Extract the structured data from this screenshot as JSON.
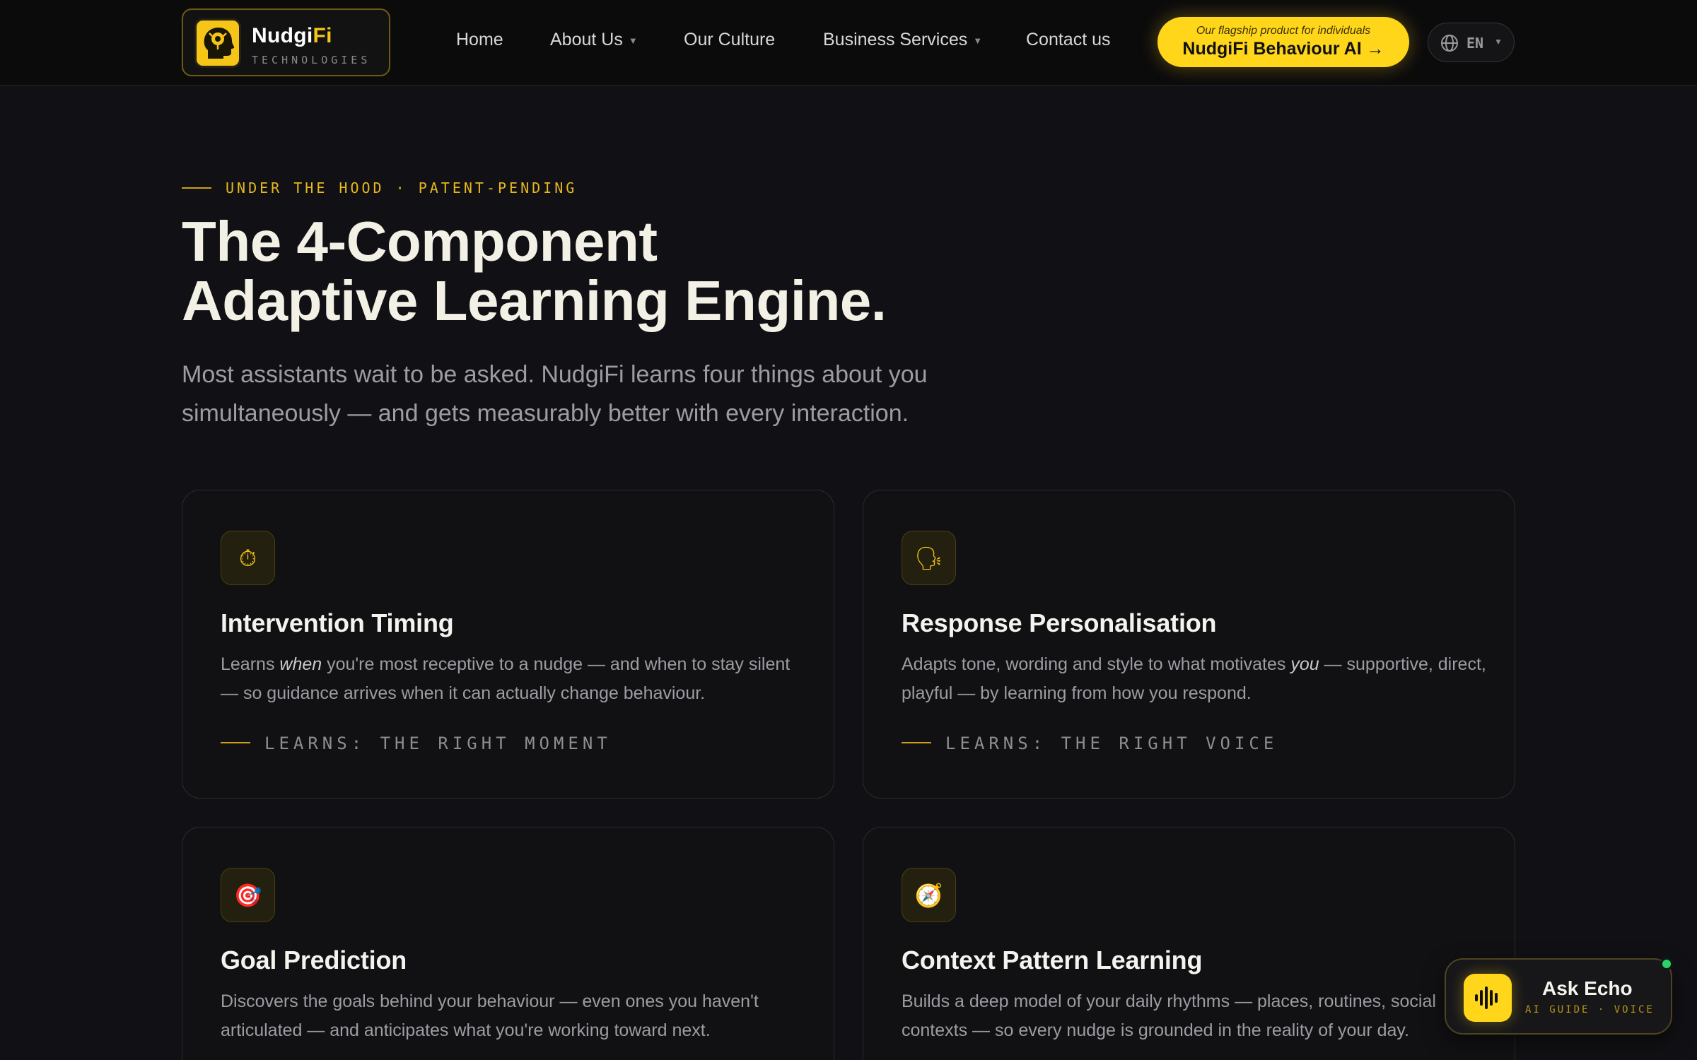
{
  "header": {
    "brand": {
      "name_main": "Nudgi",
      "name_accent": "Fi",
      "subtitle": "TECHNOLOGIES"
    },
    "nav": [
      {
        "label": "Home",
        "has_dropdown": false
      },
      {
        "label": "About Us",
        "has_dropdown": true
      },
      {
        "label": "Our Culture",
        "has_dropdown": false
      },
      {
        "label": "Business Services",
        "has_dropdown": true
      },
      {
        "label": "Contact us",
        "has_dropdown": false
      }
    ],
    "cta": {
      "kicker": "Our flagship product for individuals",
      "label": "NudgiFi Behaviour AI →"
    },
    "language": {
      "label": "EN",
      "icon": "globe-icon"
    }
  },
  "hero": {
    "eyebrow": "UNDER THE HOOD · PATENT-PENDING",
    "headline_line1": "The 4-Component",
    "headline_line2": "Adaptive Learning Engine.",
    "lede": "Most assistants wait to be asked. NudgiFi learns four things about you simultaneously — and gets measurably better with every interaction."
  },
  "cards": [
    {
      "icon": "stopwatch-icon",
      "glyph": "⏱",
      "title": "Intervention Timing",
      "body_before": "Learns ",
      "body_em": "when",
      "body_after": " you're most receptive to a nudge — and when to stay silent — so guidance arrives when it can actually change behaviour.",
      "tag": "LEARNS: THE RIGHT MOMENT"
    },
    {
      "icon": "speaking-head-icon",
      "glyph": "🗣",
      "title": "Response Personalisation",
      "body_before": "Adapts tone, wording and style to what motivates ",
      "body_em": "you",
      "body_after": " — supportive, direct, playful — by learning from how you respond.",
      "tag": "LEARNS: THE RIGHT VOICE"
    },
    {
      "icon": "target-icon",
      "glyph": "🎯",
      "title": "Goal Prediction",
      "body": "Discovers the goals behind your behaviour — even ones you haven't articulated — and anticipates what you're working toward next."
    },
    {
      "icon": "compass-icon",
      "glyph": "🧭",
      "title": "Context Pattern Learning",
      "body": "Builds a deep model of your daily rhythms — places, routines, social contexts — so every nudge is grounded in the reality of your day."
    }
  ],
  "echo_widget": {
    "title": "Ask Echo",
    "subtitle": "AI GUIDE · VOICE",
    "status_color": "#2bd46a"
  },
  "colors": {
    "accent": "#f5c518",
    "background": "#111115",
    "header_bg": "#0b0b0c",
    "muted_text": "#9c9ca2"
  }
}
